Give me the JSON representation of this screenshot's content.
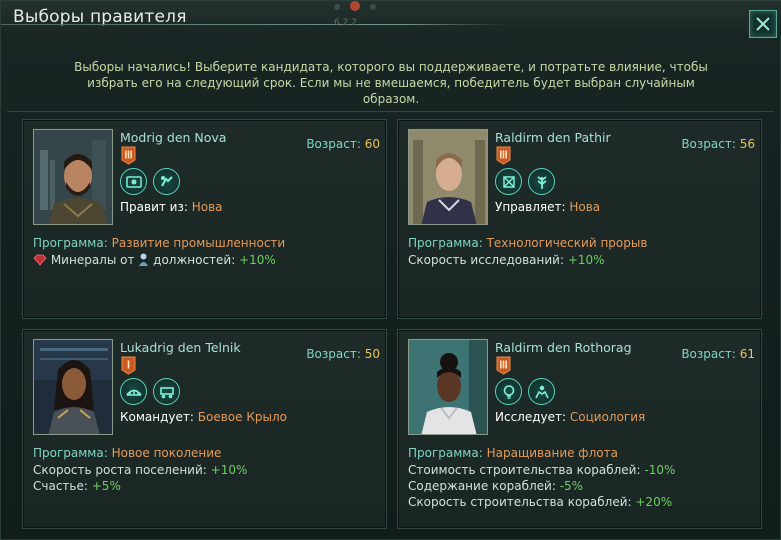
{
  "window": {
    "title": "Выборы правителя",
    "intro": "Выборы начались! Выберите кандидата, которого вы поддерживаете, и потратьте влияние, чтобы избрать его на следующий срок. Если мы не вмешаемся, победитель будет выбран случайным образом."
  },
  "labels": {
    "age": "Возраст:",
    "agenda": "Программа:"
  },
  "candidates": [
    {
      "name": "Modrig den Nova",
      "age": "60",
      "role_label": "Правит из:",
      "role_value": "Нова",
      "agenda": "Развитие промышленности",
      "effects": [
        {
          "pre": "Минералы от",
          "post": "должностей:",
          "value": "+10%"
        }
      ],
      "traits": [
        "mineral-icon",
        "thumbs-icon"
      ]
    },
    {
      "name": "Raldirm den Pathir",
      "age": "56",
      "role_label": "Управляет:",
      "role_value": "Нова",
      "agenda": "Технологический прорыв",
      "effects": [
        {
          "text": "Скорость исследований:",
          "value": "+10%"
        }
      ],
      "traits": [
        "robot-icon",
        "leaf-icon"
      ]
    },
    {
      "name": "Lukadrig den Telnik",
      "age": "50",
      "role_label": "Командует:",
      "role_value": "Боевое Крыло",
      "agenda": "Новое поколение",
      "effects": [
        {
          "text": "Скорость роста поселений:",
          "value": "+10%"
        },
        {
          "text": "Счастье:",
          "value": "+5%"
        }
      ],
      "traits": [
        "bridge-icon",
        "cart-icon"
      ]
    },
    {
      "name": "Raldirm den Rothorag",
      "age": "61",
      "role_label": "Исследует:",
      "role_value": "Социология",
      "agenda": "Наращивание флота",
      "effects": [
        {
          "text": "Стоимость строительства кораблей:",
          "value": "-10%"
        },
        {
          "text": "Содержание кораблей:",
          "value": "-5%"
        },
        {
          "text": "Скорость строительства кораблей:",
          "value": "+20%"
        }
      ],
      "traits": [
        "bulb-icon",
        "people-icon"
      ]
    }
  ],
  "colors": {
    "accent": "#7fd4c2",
    "highlight": "#e49a5a",
    "bonus": "#68d25c",
    "age_value": "#e8c35a"
  }
}
